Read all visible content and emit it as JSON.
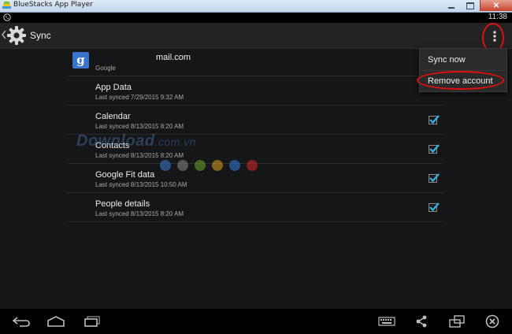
{
  "window": {
    "title": "BlueStacks App Player"
  },
  "status_bar": {
    "time": "11:38"
  },
  "action_bar": {
    "title": "Sync"
  },
  "account": {
    "email": "mail.com",
    "type": "Google",
    "logo_letter": "g"
  },
  "sync_items": [
    {
      "name": "App Data",
      "last_synced": "Last synced 7/29/2015 9:32 AM",
      "checked": true
    },
    {
      "name": "Calendar",
      "last_synced": "Last synced 8/13/2015 8:20 AM",
      "checked": true
    },
    {
      "name": "Contacts",
      "last_synced": "Last synced 8/13/2015 8:20 AM",
      "checked": true
    },
    {
      "name": "Google Fit data",
      "last_synced": "Last synced 8/13/2015 10:50 AM",
      "checked": true
    },
    {
      "name": "People details",
      "last_synced": "Last synced 8/13/2015 8:20 AM",
      "checked": true
    }
  ],
  "overflow_menu": {
    "items": [
      "Sync now",
      "Remove account"
    ]
  },
  "watermark": {
    "text": "Download",
    "suffix": ".com.vn"
  },
  "colors": {
    "accent": "#33b5e5",
    "highlight": "#e01010",
    "google_blue": "#3874c9"
  },
  "icons": {
    "nav": [
      "back-icon",
      "home-icon",
      "recent-apps-icon",
      "keyboard-icon",
      "share-icon",
      "screen-rotate-icon",
      "close-icon"
    ]
  }
}
